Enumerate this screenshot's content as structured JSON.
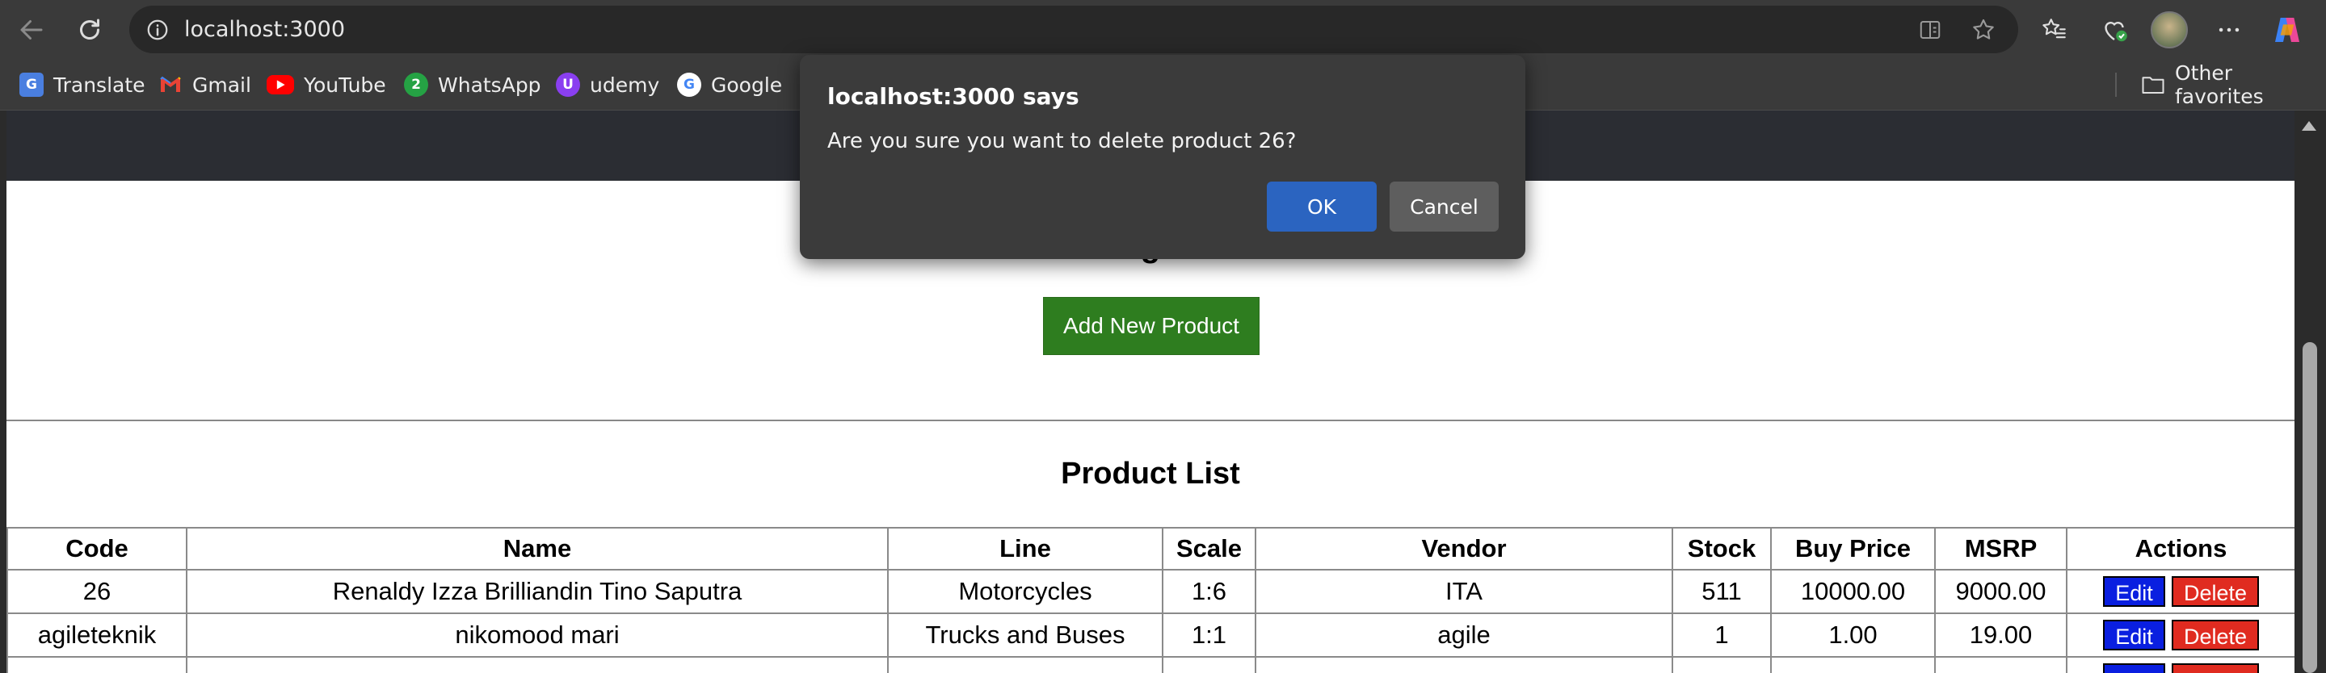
{
  "browser": {
    "url": "localhost:3000",
    "bookmarks": [
      {
        "label": "Translate",
        "icon": "translate-icon"
      },
      {
        "label": "Gmail",
        "icon": "gmail-icon"
      },
      {
        "label": "YouTube",
        "icon": "youtube-icon"
      },
      {
        "label": "WhatsApp",
        "icon": "whatsapp-icon"
      },
      {
        "label": "udemy",
        "icon": "udemy-icon"
      },
      {
        "label": "Google",
        "icon": "google-icon"
      }
    ],
    "other_favorites": "Other favorites"
  },
  "page": {
    "add_button": "Add New Product",
    "list_title": "Product List",
    "table": {
      "headers": [
        "Code",
        "Name",
        "Line",
        "Scale",
        "Vendor",
        "Stock",
        "Buy Price",
        "MSRP",
        "Actions"
      ],
      "rows": [
        [
          "26",
          "Renaldy Izza Brilliandin Tino Saputra",
          "Motorcycles",
          "1:6",
          "ITA",
          "511",
          "10000.00",
          "9000.00"
        ],
        [
          "agileteknik",
          "nikomood mari",
          "Trucks and Buses",
          "1:1",
          "agile",
          "1",
          "1.00",
          "19.00"
        ]
      ],
      "edit_label": "Edit",
      "delete_label": "Delete"
    }
  },
  "dialog": {
    "title": "localhost:3000 says",
    "message": "Are you sure you want to delete product 26?",
    "ok_label": "OK",
    "cancel_label": "Cancel"
  },
  "colors": {
    "add_button": "#2e7d1f",
    "edit_button": "#0a1fe0",
    "delete_button": "#e02b20",
    "dialog_ok": "#2b64c0"
  }
}
